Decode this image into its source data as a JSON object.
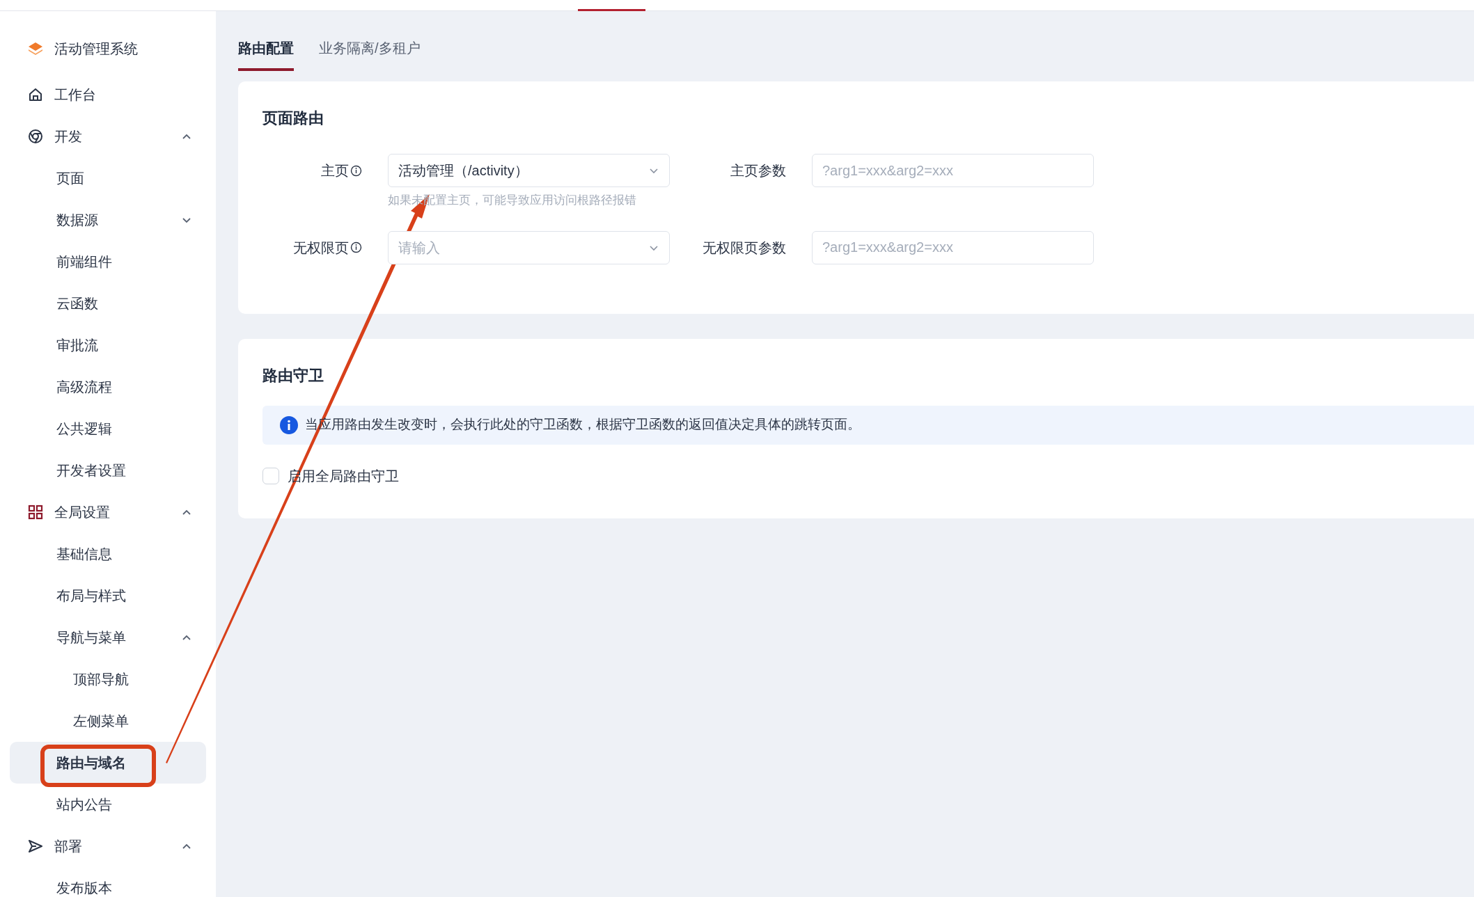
{
  "sidebar": {
    "app_title": "活动管理系统",
    "items": [
      {
        "label": "工作台",
        "selected": false
      },
      {
        "label": "开发",
        "selected": false,
        "expanded": true,
        "children": [
          {
            "label": "页面",
            "selected": false
          },
          {
            "label": "数据源",
            "selected": false,
            "expanded": false
          },
          {
            "label": "前端组件",
            "selected": false
          },
          {
            "label": "云函数",
            "selected": false
          },
          {
            "label": "审批流",
            "selected": false
          },
          {
            "label": "高级流程",
            "selected": false
          },
          {
            "label": "公共逻辑",
            "selected": false
          },
          {
            "label": "开发者设置",
            "selected": false
          }
        ]
      },
      {
        "label": "全局设置",
        "selected": false,
        "expanded": true,
        "children": [
          {
            "label": "基础信息",
            "selected": false
          },
          {
            "label": "布局与样式",
            "selected": false
          },
          {
            "label": "导航与菜单",
            "selected": false,
            "expanded": true,
            "children": [
              {
                "label": "顶部导航",
                "selected": false
              },
              {
                "label": "左侧菜单",
                "selected": false
              }
            ]
          },
          {
            "label": "路由与域名",
            "selected": true
          },
          {
            "label": "站内公告",
            "selected": false
          }
        ]
      },
      {
        "label": "部署",
        "selected": false,
        "expanded": true,
        "children": [
          {
            "label": "发布版本",
            "selected": false
          }
        ]
      }
    ]
  },
  "tabs": [
    {
      "label": "路由配置",
      "selected": true
    },
    {
      "label": "业务隔离/多租户",
      "selected": false
    }
  ],
  "page_route": {
    "title": "页面路由",
    "fields": [
      {
        "label": "主页",
        "info": true,
        "kind": "select",
        "value": "活动管理（/activity）",
        "help": "如果未配置主页，可能导致应用访问根路径报错"
      },
      {
        "label": "主页参数",
        "info": false,
        "kind": "input",
        "placeholder": "?arg1=xxx&arg2=xxx"
      },
      {
        "label": "无权限页",
        "info": true,
        "kind": "select",
        "placeholder": "请输入"
      },
      {
        "label": "无权限页参数",
        "info": false,
        "kind": "input",
        "placeholder": "?arg1=xxx&arg2=xxx"
      }
    ]
  },
  "route_guard": {
    "title": "路由守卫",
    "alert": "当应用路由发生改变时，会执行此处的守卫函数，根据守卫函数的返回值决定具体的跳转页面。",
    "checkbox": {
      "label": "启用全局路由守卫",
      "checked": false
    }
  }
}
